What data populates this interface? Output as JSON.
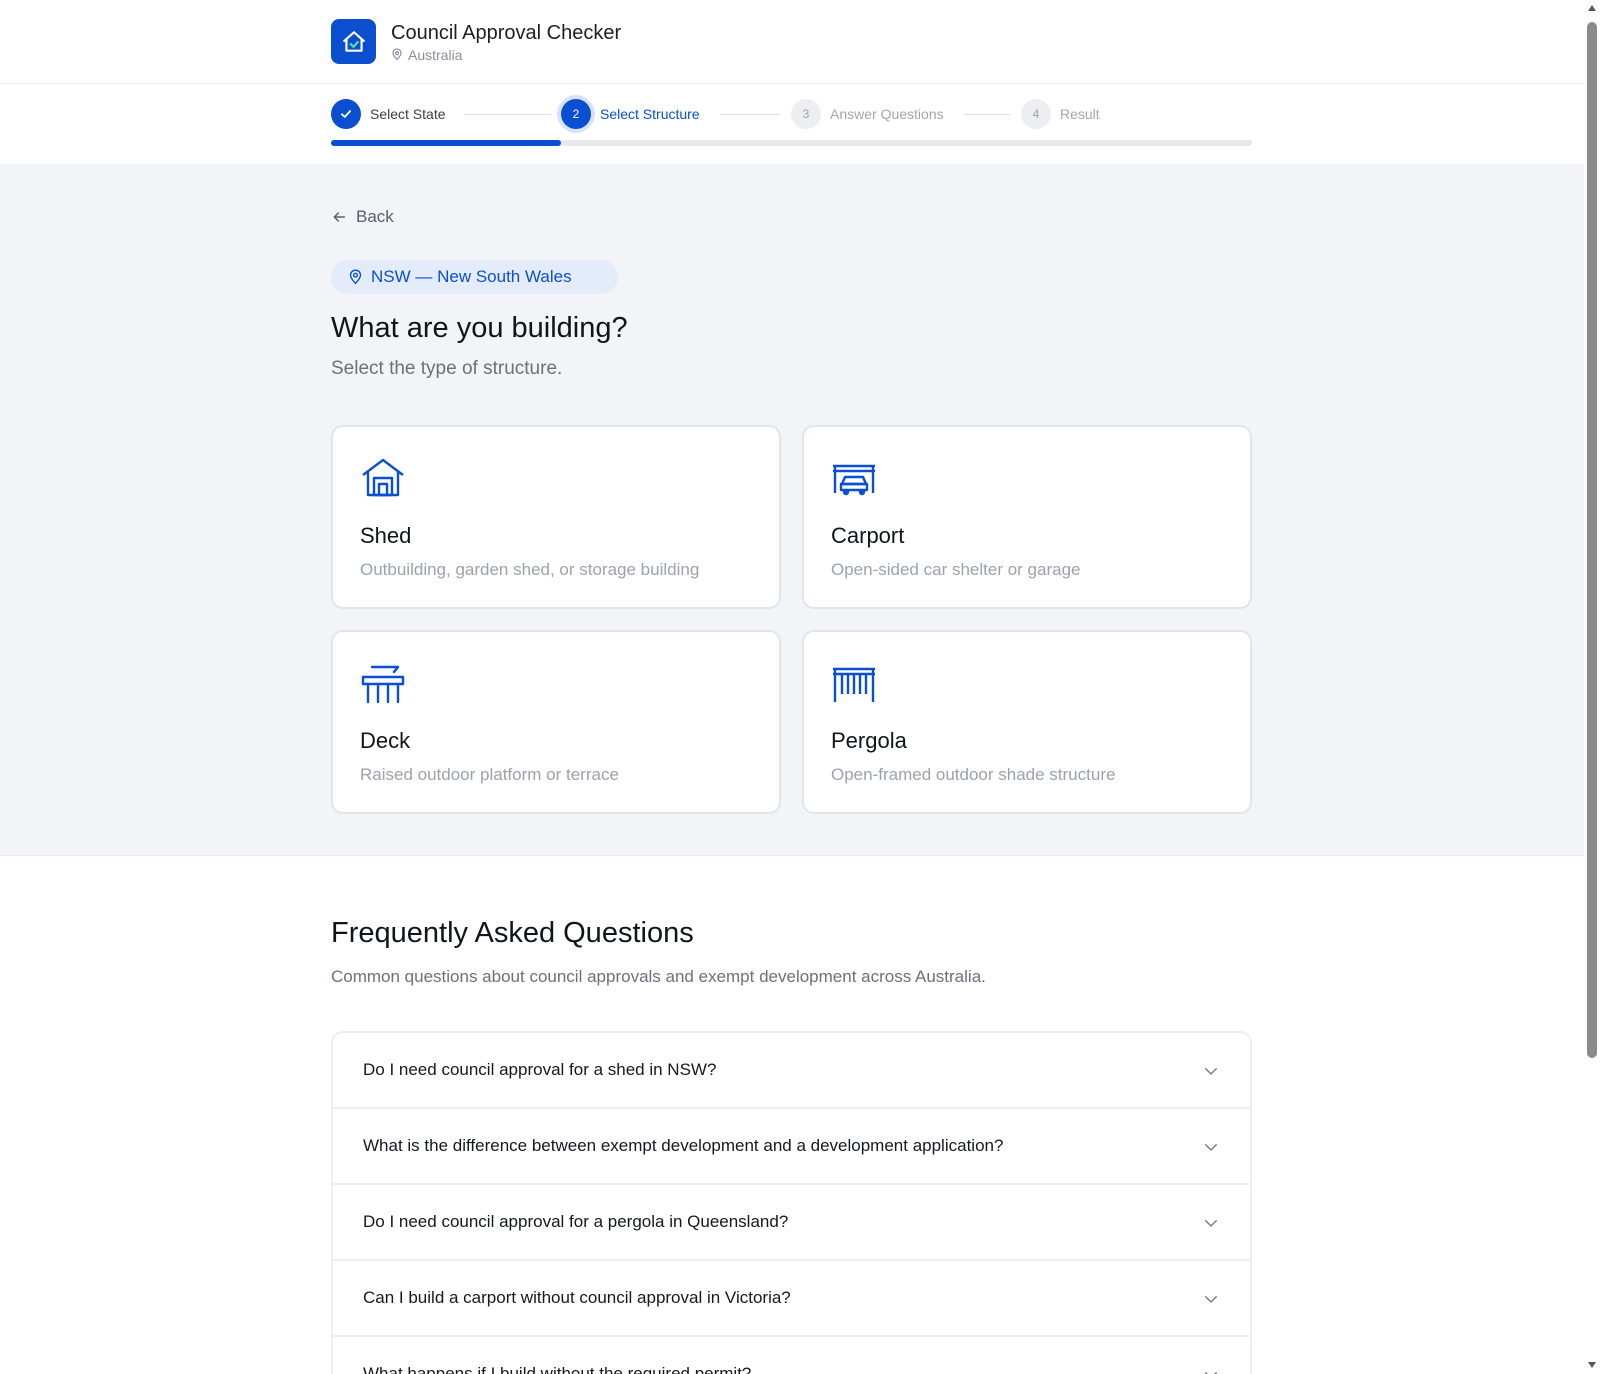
{
  "header": {
    "title": "Council Approval Checker",
    "location": "Australia",
    "logo_icon": "home-check-icon",
    "location_icon": "map-pin-icon"
  },
  "stepper": {
    "steps": [
      {
        "number": "1",
        "label": "Select State",
        "status": "done"
      },
      {
        "number": "2",
        "label": "Select Structure",
        "status": "active"
      },
      {
        "number": "3",
        "label": "Answer Questions",
        "status": "todo"
      },
      {
        "number": "4",
        "label": "Result",
        "status": "todo"
      }
    ],
    "progress_fraction": 0.25
  },
  "main": {
    "back_label": "Back",
    "state_chip": "NSW — New South Wales",
    "heading": "What are you building?",
    "subheading": "Select the type of structure.",
    "cards": [
      {
        "title": "Shed",
        "description": "Outbuilding, garden shed, or storage building",
        "icon": "shed-icon"
      },
      {
        "title": "Carport",
        "description": "Open-sided car shelter or garage",
        "icon": "carport-icon"
      },
      {
        "title": "Deck",
        "description": "Raised outdoor platform or terrace",
        "icon": "deck-icon"
      },
      {
        "title": "Pergola",
        "description": "Open-framed outdoor shade structure",
        "icon": "pergola-icon"
      }
    ]
  },
  "faq": {
    "title": "Frequently Asked Questions",
    "subtitle": "Common questions about council approvals and exempt development across Australia.",
    "items": [
      "Do I need council approval for a shed in NSW?",
      "What is the difference between exempt development and a development application?",
      "Do I need council approval for a pergola in Queensland?",
      "Can I build a carport without council approval in Victoria?",
      "What happens if I build without the required permit?"
    ]
  },
  "colors": {
    "accent": "#0a4fcf",
    "background_section": "#f3f4f7",
    "chip_background": "#e4ecfb"
  }
}
